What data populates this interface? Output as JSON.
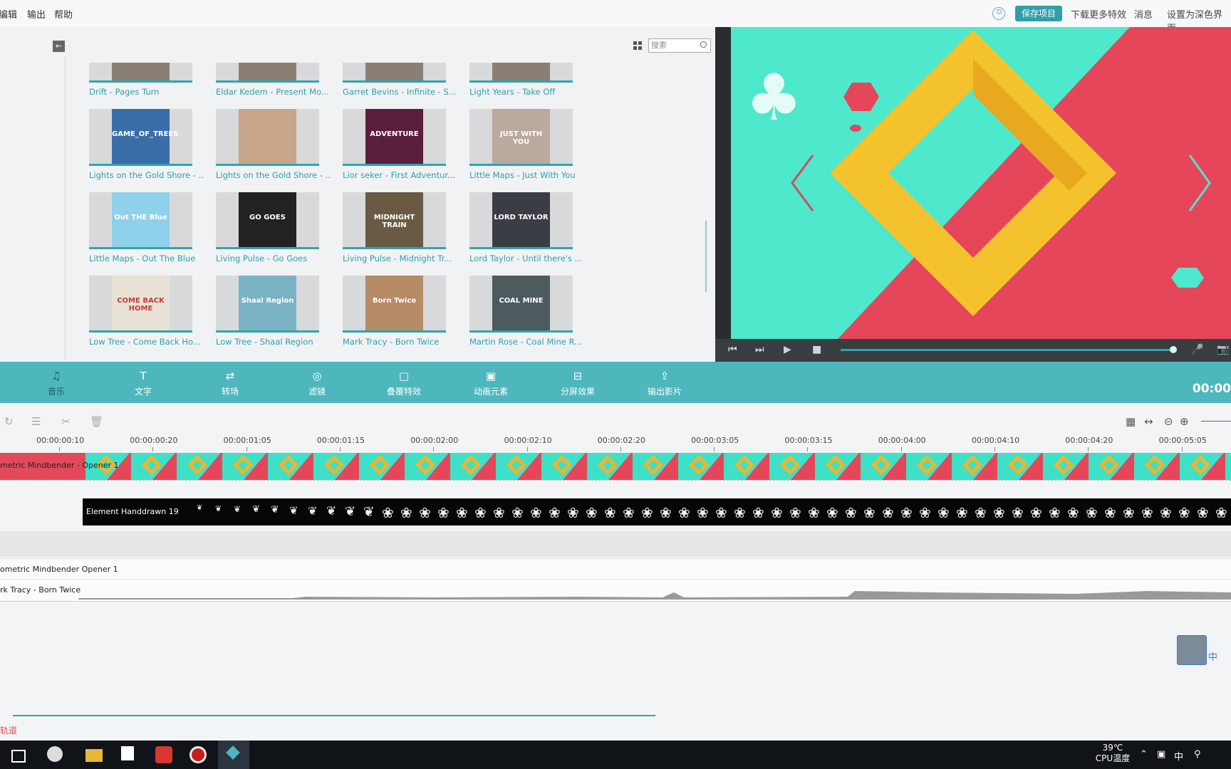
{
  "menu": {
    "edit": "编辑",
    "export": "输出",
    "help": "帮助"
  },
  "menu_right": {
    "save": "保存项目",
    "download_effects": "下载更多特效",
    "messages": "消息",
    "dark_theme": "设置为深色界面"
  },
  "library": {
    "search_placeholder": "搜索",
    "items": [
      {
        "title": "Drift - Pages Turn"
      },
      {
        "title": "Eldar Kedem - Present Mo..."
      },
      {
        "title": "Garret Bevins - Infinite - S..."
      },
      {
        "title": "Light Years - Take Off"
      },
      {
        "title": "Lights on the Gold Shore - ...",
        "art_text": "GAME_OF_TREES",
        "art_color": "#3a6ea8"
      },
      {
        "title": "Lights on the Gold Shore - ...",
        "art_text": "",
        "art_color": "#c9a58a"
      },
      {
        "title": "Lior seker - First Adventur...",
        "art_text": "ADVENTURE",
        "art_color": "#5a1f3c"
      },
      {
        "title": "Little Maps - Just With You",
        "art_text": "JUST WITH YOU",
        "art_color": "#b9a99f"
      },
      {
        "title": "Little Maps - Out The Blue",
        "art_text": "Out THE Blue",
        "art_color": "#8fd0ea"
      },
      {
        "title": "Living Pulse - Go Goes",
        "art_text": "GO GOES",
        "art_color": "#222222"
      },
      {
        "title": "Living Pulse - Midnight Tr...",
        "art_text": "MIDNIGHT TRAIN",
        "art_color": "#6a5a44"
      },
      {
        "title": "Lord Taylor - Until there's ...",
        "art_text": "LORD TAYLOR",
        "art_color": "#3a3d44"
      },
      {
        "title": "Low Tree - Come Back Ho...",
        "art_text": "COME BACK HOME",
        "art_color": "#e8e2d6"
      },
      {
        "title": "Low Tree - Shaal Region",
        "art_text": "Shaal Region",
        "art_color": "#7ab3c4"
      },
      {
        "title": "Mark Tracy - Born Twice",
        "art_text": "Born Twice",
        "art_color": "#b58c66"
      },
      {
        "title": "Martin Rose - Coal Mine R...",
        "art_text": "COAL MINE",
        "art_color": "#4d5a5e"
      }
    ]
  },
  "toolbar": {
    "tools": [
      {
        "label": "音乐",
        "icon": "music-icon"
      },
      {
        "label": "文字",
        "icon": "text-icon"
      },
      {
        "label": "转场",
        "icon": "transition-icon"
      },
      {
        "label": "滤镜",
        "icon": "filter-icon"
      },
      {
        "label": "叠覆特效",
        "icon": "overlay-icon"
      },
      {
        "label": "动画元素",
        "icon": "element-icon"
      },
      {
        "label": "分屏效果",
        "icon": "split-screen-icon"
      },
      {
        "label": "输出影片",
        "icon": "export-icon"
      }
    ],
    "timecode": "00:00"
  },
  "timeline": {
    "ruler": [
      "00:00:00:10",
      "00:00:00:20",
      "00:00:01:05",
      "00:00:01:15",
      "00:00:02:00",
      "00:00:02:10",
      "00:00:02:20",
      "00:00:03:05",
      "00:00:03:15",
      "00:00:04:00",
      "00:00:04:10",
      "00:00:04:20",
      "00:00:05:05"
    ],
    "video_clip": "metric Mindbender - Opener 1",
    "overlay_clip": "Element Handdrawn 19",
    "audio_tracks": [
      "ometric Mindbender Opener 1",
      "rk Tracy - Born Twice"
    ],
    "track_label": "轨道"
  },
  "taskbar": {
    "temp": "39℃",
    "cpu_label": "CPU温度",
    "ime": "中"
  },
  "colors": {
    "accent": "#4db7bd",
    "teal": "#2fa5ae",
    "coral": "#e5465a",
    "gold": "#f0b42a"
  }
}
